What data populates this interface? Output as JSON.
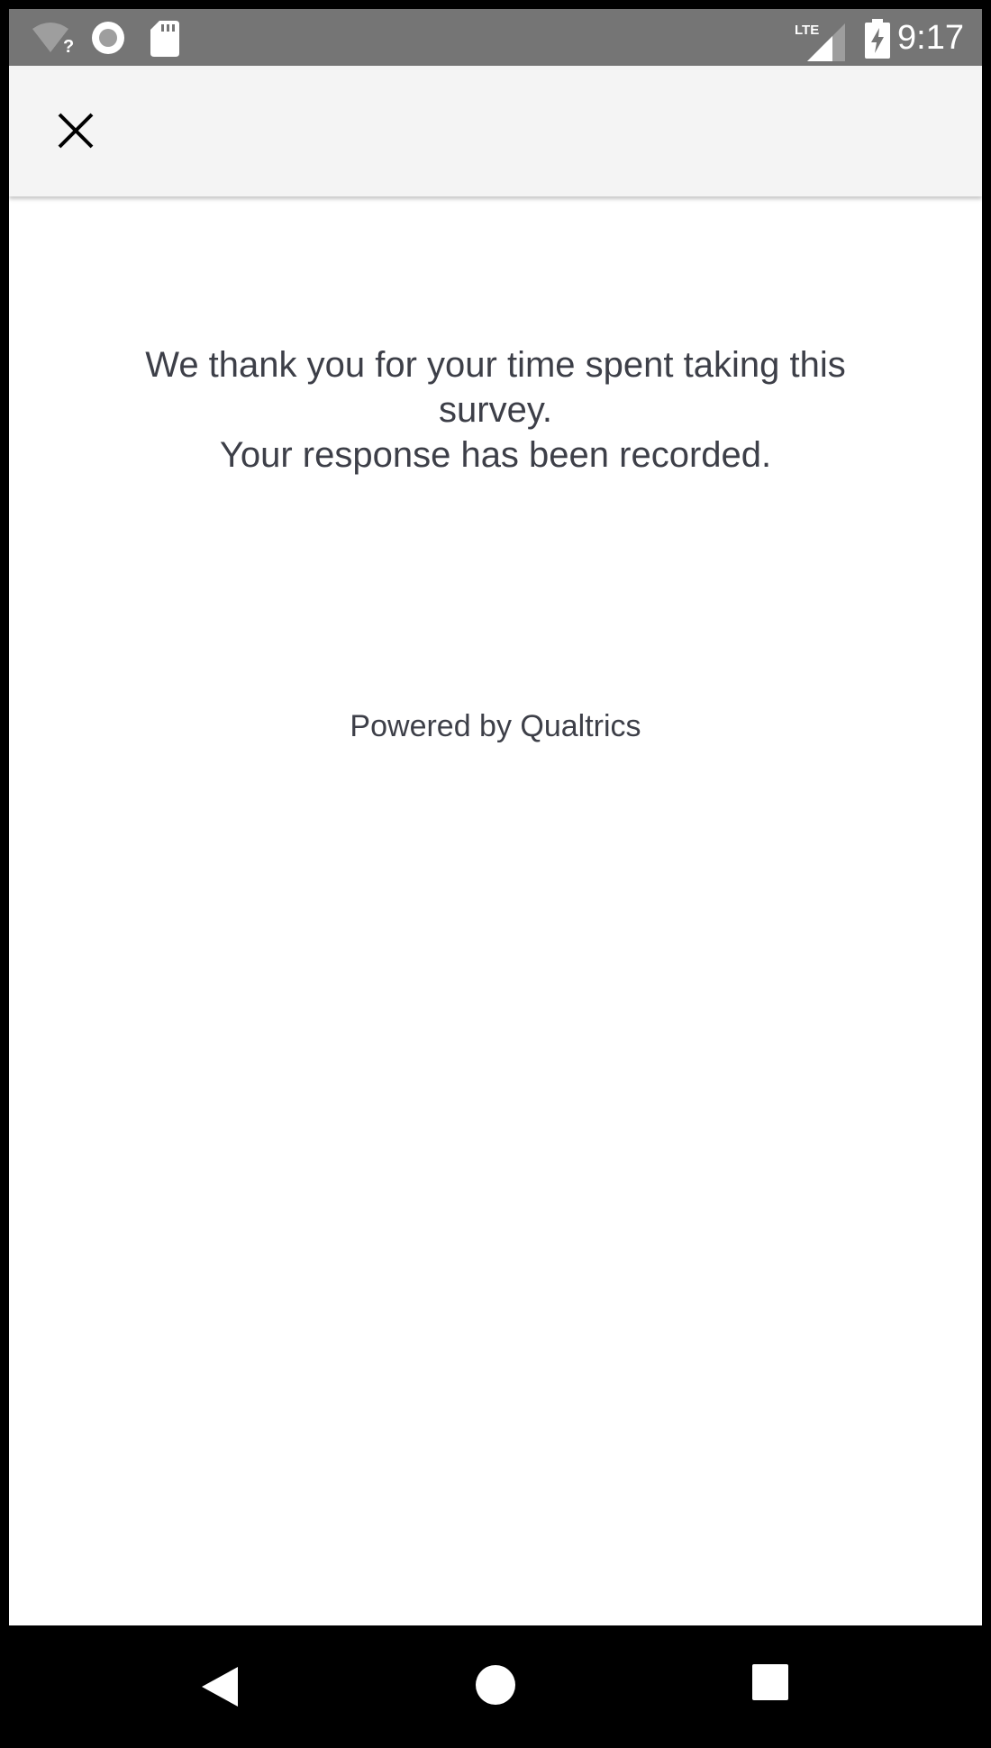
{
  "status_bar": {
    "time": "9:17",
    "network": "LTE",
    "icons": [
      "wifi-unknown-icon",
      "sync-icon",
      "sd-card-icon",
      "lte-signal-icon",
      "battery-charging-icon"
    ]
  },
  "toolbar": {
    "close_icon": "close-icon"
  },
  "message": {
    "line1": "We thank you for your time spent taking this survey.",
    "line2": "Your response has been recorded."
  },
  "footer": {
    "powered_by": "Powered by Qualtrics"
  },
  "nav_bar": {
    "icons": [
      "back-icon",
      "home-icon",
      "recents-icon"
    ]
  },
  "colors": {
    "status_bar": "#757575",
    "toolbar": "#f4f4f4",
    "text": "#3d3f48",
    "background": "#ffffff"
  }
}
